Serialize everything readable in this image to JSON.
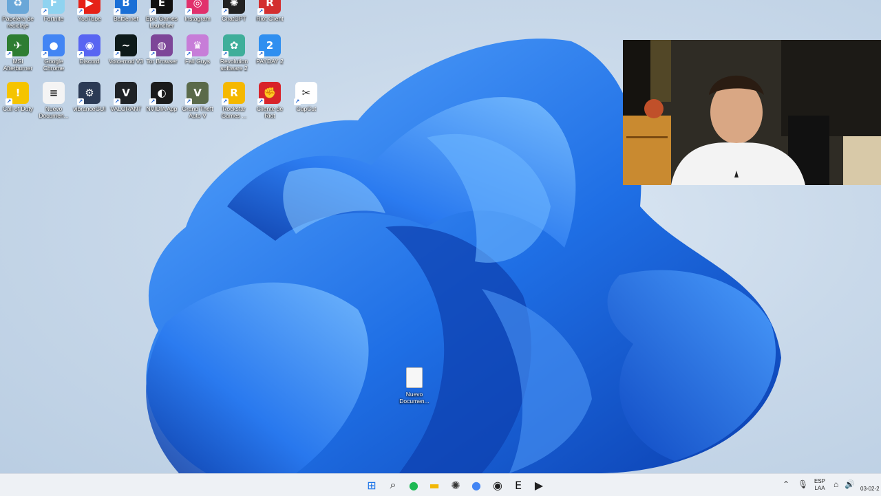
{
  "desktop": {
    "icons": [
      {
        "name": "recycle-bin-icon",
        "label": "Papelera de reciclaje",
        "color": "#6aa7d8",
        "glyph": "♻"
      },
      {
        "name": "fortnite-icon",
        "label": "Fortnite",
        "color": "#8fd3f0",
        "glyph": "F"
      },
      {
        "name": "youtube-icon",
        "label": "YouTube",
        "color": "#e62117",
        "glyph": "▶"
      },
      {
        "name": "battlenet-icon",
        "label": "Battle.net",
        "color": "#1a6fd6",
        "glyph": "B"
      },
      {
        "name": "epic-games-icon",
        "label": "Epic Games Launcher",
        "color": "#111111",
        "glyph": "E"
      },
      {
        "name": "instagram-icon",
        "label": "Instagram",
        "color": "#e1306c",
        "glyph": "◎"
      },
      {
        "name": "chatgpt-icon",
        "label": "ChatGPT",
        "color": "#222222",
        "glyph": "✺"
      },
      {
        "name": "riot-client-icon",
        "label": "Riot Client",
        "color": "#d32f2f",
        "glyph": "R"
      },
      {
        "name": "msi-afterburner-icon",
        "label": "MSI Afterburner",
        "color": "#2e7d32",
        "glyph": "✈"
      },
      {
        "name": "google-chrome-icon",
        "label": "Google Chrome",
        "color": "#4285f4",
        "glyph": "●"
      },
      {
        "name": "discord-icon",
        "label": "Discord",
        "color": "#5865f2",
        "glyph": "◉"
      },
      {
        "name": "voicemod-icon",
        "label": "Voicemod V3",
        "color": "#0d1a1a",
        "glyph": "~"
      },
      {
        "name": "tor-browser-icon",
        "label": "Tor Browser",
        "color": "#7d4698",
        "glyph": "◍"
      },
      {
        "name": "fall-guys-icon",
        "label": "Fall Guys",
        "color": "#c77dd8",
        "glyph": "♛"
      },
      {
        "name": "revolution-software-icon",
        "label": "Revolution software 2",
        "color": "#3fae9a",
        "glyph": "✿"
      },
      {
        "name": "payday2-icon",
        "label": "PAYDAY 2",
        "color": "#2f8ff0",
        "glyph": "2"
      },
      {
        "name": "call-of-duty-icon",
        "label": "Call of Duty",
        "color": "#f5c400",
        "glyph": "!"
      },
      {
        "name": "text-document-icon",
        "label": "Nuevo Documen...",
        "color": "#f4f4f4",
        "glyph": "≡"
      },
      {
        "name": "vibrancegui-icon",
        "label": "vibranceGUI",
        "color": "#2b3a55",
        "glyph": "⚙"
      },
      {
        "name": "valorant-icon",
        "label": "VALORANT",
        "color": "#1f2226",
        "glyph": "V"
      },
      {
        "name": "nvidia-app-icon",
        "label": "NVIDIA App",
        "color": "#1b1b1b",
        "glyph": "◐"
      },
      {
        "name": "gta5-icon",
        "label": "Grand Theft Auto V",
        "color": "#5a6a4a",
        "glyph": "V"
      },
      {
        "name": "rockstar-games-icon",
        "label": "Rockstar Games ...",
        "color": "#f5b800",
        "glyph": "R"
      },
      {
        "name": "riot-client-es-icon",
        "label": "Cliente de Riot",
        "color": "#d8232a",
        "glyph": "✊"
      },
      {
        "name": "capcut-icon",
        "label": "CapCut",
        "color": "#ffffff",
        "glyph": "✂"
      }
    ],
    "center_file": {
      "label": "Nuevo Documen..."
    }
  },
  "taskbar": {
    "apps": [
      {
        "name": "start-icon",
        "color": "#1a73e8",
        "glyph": "⊞"
      },
      {
        "name": "search-icon",
        "color": "#333333",
        "glyph": "⌕"
      },
      {
        "name": "spotify-icon",
        "color": "#1db954",
        "glyph": "●"
      },
      {
        "name": "file-explorer-icon",
        "color": "#f2b705",
        "glyph": "▬"
      },
      {
        "name": "chatgpt-taskbar-icon",
        "color": "#333333",
        "glyph": "✺"
      },
      {
        "name": "chrome-taskbar-icon",
        "color": "#4285f4",
        "glyph": "●"
      },
      {
        "name": "obs-icon",
        "color": "#222222",
        "glyph": "◉"
      },
      {
        "name": "epic-taskbar-icon",
        "color": "#111111",
        "glyph": "E"
      },
      {
        "name": "media-player-icon",
        "color": "#222222",
        "glyph": "▶"
      }
    ],
    "tray": {
      "lang_top": "ESP",
      "lang_bottom": "LAA",
      "date": "03-02-2"
    }
  },
  "colors": {
    "accent": "#1a73e8",
    "wallpaper_blue": "#1f6fe5"
  }
}
